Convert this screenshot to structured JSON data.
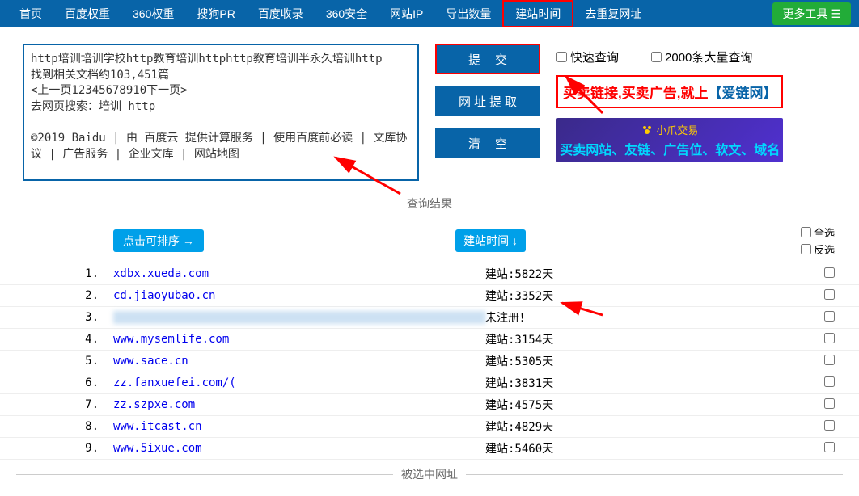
{
  "nav": {
    "items": [
      "首页",
      "百度权重",
      "360权重",
      "搜狗PR",
      "百度收录",
      "360安全",
      "网站IP",
      "导出数量",
      "建站时间",
      "去重复网址"
    ],
    "active_index": 8,
    "more": "更多工具"
  },
  "textarea": {
    "content": "http培训培训学校http教育培训httphttp教育培训半永久培训http\n找到相关文档约103,451篇\n<上一页12345678910下一页>\n去网页搜索：培训 http\n\n©2019 Baidu | 由 百度云 提供计算服务 | 使用百度前必读 | 文库协议 | 广告服务 | 企业文库 | 网站地图"
  },
  "buttons": {
    "submit": "提交",
    "extract": "网址提取",
    "clear": "清空"
  },
  "checkboxes": {
    "fast": "快速查询",
    "bulk": "2000条大量查询"
  },
  "ads": {
    "ad1_part1": "买卖链接,买卖广告,就上",
    "ad1_part2": "【爱链网】",
    "ad2_brand": "小爪交易",
    "ad2_text": "买卖网站、友链、广告位、软文、域名"
  },
  "dividers": {
    "results": "查询结果",
    "selected": "被选中网址"
  },
  "header": {
    "sort": "点击可排序 →",
    "time": "建站时间 ↓",
    "select_all": "全选",
    "invert": "反选"
  },
  "rows": [
    {
      "num": "1.",
      "url": "xdbx.xueda.com",
      "time": "建站:5822天",
      "blur": false
    },
    {
      "num": "2.",
      "url": "cd.jiaoyubao.cn",
      "time": "建站:3352天",
      "blur": false
    },
    {
      "num": "3.",
      "url": "hidden.example.cn",
      "time": "未注册！",
      "blur": true
    },
    {
      "num": "4.",
      "url": "www.mysemlife.com",
      "time": "建站:3154天",
      "blur": false
    },
    {
      "num": "5.",
      "url": "www.sace.cn",
      "time": "建站:5305天",
      "blur": false
    },
    {
      "num": "6.",
      "url": "zz.fanxuefei.com/(",
      "time": "建站:3831天",
      "blur": false
    },
    {
      "num": "7.",
      "url": "zz.szpxe.com",
      "time": "建站:4575天",
      "blur": false
    },
    {
      "num": "8.",
      "url": "www.itcast.cn",
      "time": "建站:4829天",
      "blur": false
    },
    {
      "num": "9.",
      "url": "www.5ixue.com",
      "time": "建站:5460天",
      "blur": false
    }
  ]
}
